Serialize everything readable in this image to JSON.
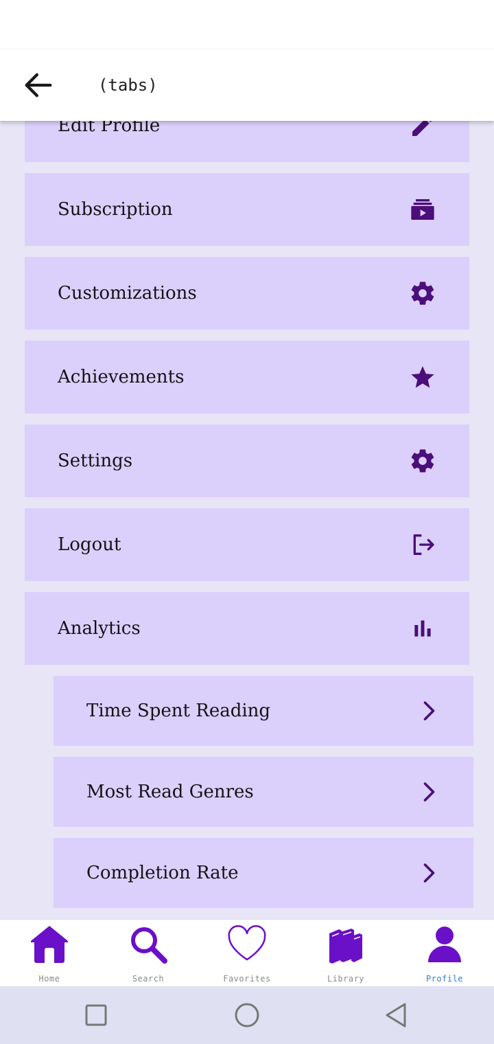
{
  "header": {
    "title": "(tabs)",
    "back_icon": "arrow-left-icon"
  },
  "colors": {
    "accent": "#6a10c8",
    "icon_dark": "#4b0e7a",
    "item_bg": "#dbd0fc",
    "page_bg": "#e7e5f6",
    "active_tab_label": "#2f7fd0"
  },
  "menu": {
    "items": [
      {
        "label": "Edit Profile",
        "icon": "pencil-icon"
      },
      {
        "label": "Subscription",
        "icon": "subscription-icon"
      },
      {
        "label": "Customizations",
        "icon": "gear-icon"
      },
      {
        "label": "Achievements",
        "icon": "star-icon"
      },
      {
        "label": "Settings",
        "icon": "gear-icon"
      },
      {
        "label": "Logout",
        "icon": "logout-icon"
      },
      {
        "label": "Analytics",
        "icon": "bar-chart-icon"
      }
    ],
    "analytics_sub_items": [
      {
        "label": "Time Spent Reading",
        "icon": "chevron-right-icon"
      },
      {
        "label": "Most Read Genres",
        "icon": "chevron-right-icon"
      },
      {
        "label": "Completion Rate",
        "icon": "chevron-right-icon"
      }
    ]
  },
  "tabs": [
    {
      "label": "Home",
      "icon": "home-icon",
      "active": false
    },
    {
      "label": "Search",
      "icon": "search-icon",
      "active": false
    },
    {
      "label": "Favorites",
      "icon": "heart-icon",
      "active": false
    },
    {
      "label": "Library",
      "icon": "books-icon",
      "active": false
    },
    {
      "label": "Profile",
      "icon": "user-icon",
      "active": true
    }
  ],
  "system_nav": {
    "buttons": [
      "recents-icon",
      "home-circle-icon",
      "back-triangle-icon"
    ]
  }
}
